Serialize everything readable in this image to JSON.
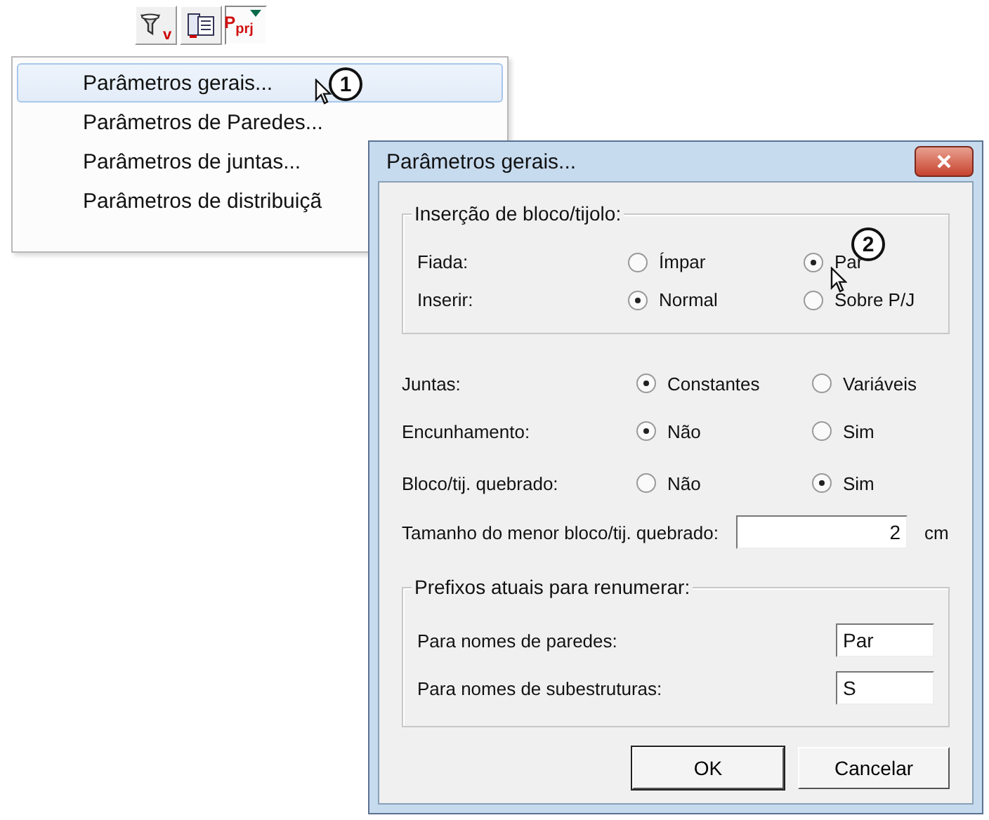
{
  "toolbar": [
    {
      "kind": "filter",
      "label": "v",
      "selected": false
    },
    {
      "kind": "document",
      "selected": false
    },
    {
      "kind": "project",
      "label": "P$_{prj}$",
      "selected": true
    }
  ],
  "menu": {
    "items": [
      {
        "label": "Parâmetros gerais...",
        "selected": true
      },
      {
        "label": "Parâmetros de Paredes...",
        "selected": false
      },
      {
        "label": "Parâmetros de juntas...",
        "selected": false
      },
      {
        "label": "Parâmetros de distribuiçã",
        "selected": false
      }
    ]
  },
  "callouts": [
    {
      "number": "1"
    },
    {
      "number": "2"
    }
  ],
  "dialog": {
    "title": "Parâmetros gerais...",
    "insertion_group": {
      "title": "Inserção de bloco/tijolo:",
      "rows": [
        {
          "label": "Fiada:",
          "options": [
            {
              "label": "Ímpar",
              "selected": false
            },
            {
              "label": "Par",
              "selected": true
            }
          ]
        },
        {
          "label": "Inserir:",
          "options": [
            {
              "label": "Normal",
              "selected": true
            },
            {
              "label": "Sobre P/J",
              "selected": false
            }
          ]
        }
      ]
    },
    "rows": [
      {
        "label": "Juntas:",
        "options": [
          {
            "label": "Constantes",
            "selected": true
          },
          {
            "label": "Variáveis",
            "selected": false
          }
        ]
      },
      {
        "label": "Encunhamento:",
        "options": [
          {
            "label": "Não",
            "selected": true
          },
          {
            "label": "Sim",
            "selected": false
          }
        ]
      },
      {
        "label": "Bloco/tij. quebrado:",
        "options": [
          {
            "label": "Não",
            "selected": false
          },
          {
            "label": "Sim",
            "selected": true
          }
        ]
      }
    ],
    "min_size": {
      "label": "Tamanho do menor bloco/tij. quebrado:",
      "value": "2",
      "unit": "cm"
    },
    "prefix_group": {
      "title": "Prefixos atuais para renumerar:",
      "fields": [
        {
          "label": "Para nomes de paredes:",
          "value": "Par"
        },
        {
          "label": "Para nomes de subestruturas:",
          "value": "S"
        }
      ]
    },
    "buttons": [
      {
        "label": "OK",
        "kind": "default"
      },
      {
        "label": "Cancelar",
        "kind": "normal"
      }
    ]
  }
}
